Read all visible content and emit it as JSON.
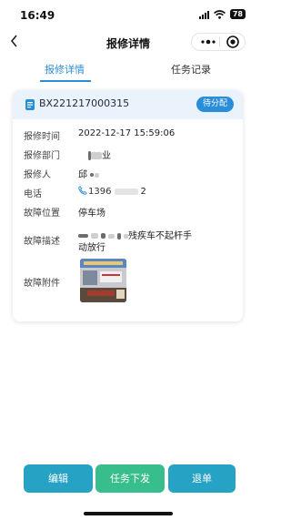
{
  "status_bar": {
    "time": "16:49",
    "battery": "78",
    "signal_icon": "signal-icon",
    "wifi_icon": "wifi-icon"
  },
  "nav": {
    "title": "报修详情",
    "back_icon": "chevron-left-icon",
    "more_icon": "more-dots-icon",
    "close_icon": "target-close-icon"
  },
  "tabs": [
    {
      "label": "报修详情",
      "active": true
    },
    {
      "label": "任务记录",
      "active": false
    }
  ],
  "card": {
    "order_no": "BX221217000315",
    "status": "待分配",
    "fields": {
      "report_time": {
        "label": "报修时间",
        "value": "2022-12-17 15:59:06"
      },
      "department": {
        "label": "报修部门",
        "value_visible": "业"
      },
      "reporter": {
        "label": "报修人",
        "value_visible": "邱"
      },
      "phone": {
        "label": "电话",
        "value_start": "1396",
        "value_end": "2"
      },
      "location": {
        "label": "故障位置",
        "value": "停车场"
      },
      "description": {
        "label": "故障描述",
        "line1_visible": "残疾车不起杆手",
        "line2": "动放行"
      },
      "attachment": {
        "label": "故障附件"
      }
    }
  },
  "actions": {
    "edit": "编辑",
    "dispatch": "任务下发",
    "return": "退单"
  },
  "colors": {
    "primary": "#2a8dd8",
    "teal": "#25a2c4",
    "green": "#38bd8d",
    "card_header": "#eaf3fc"
  }
}
